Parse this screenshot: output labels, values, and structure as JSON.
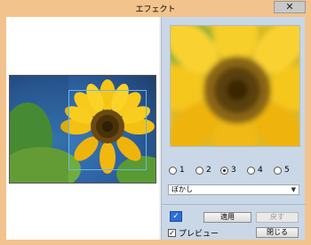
{
  "window": {
    "title": "エフェクト",
    "close_glyph": "✕"
  },
  "effect": {
    "levels": [
      {
        "label": "1",
        "selected": false
      },
      {
        "label": "2",
        "selected": false
      },
      {
        "label": "3",
        "selected": true
      },
      {
        "label": "4",
        "selected": false
      },
      {
        "label": "5",
        "selected": false
      }
    ],
    "effect_type": {
      "selected": "ぼかし"
    },
    "brush_icon": "brush-icon",
    "apply_label": "適用",
    "undo_label": "戻す",
    "close_label": "閉じる",
    "preview_label": "プレビュー",
    "preview_checked": true
  },
  "colors": {
    "title_bar": "#f3c38d",
    "accent": "#2b6fd6",
    "right_pane": "#c9d7e6"
  }
}
